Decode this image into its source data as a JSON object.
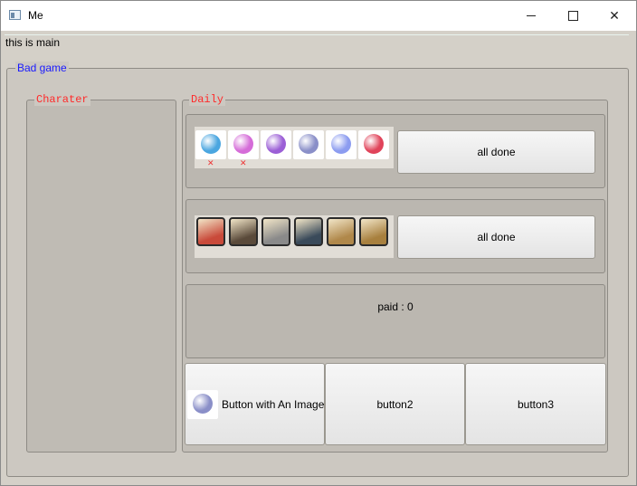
{
  "window": {
    "title": "Me",
    "controls": [
      "minimize",
      "maximize",
      "close"
    ]
  },
  "menubar": {
    "text": "this is main"
  },
  "main_group": {
    "title": "Bad game"
  },
  "character_group": {
    "title": "Charater"
  },
  "daily_group": {
    "title": "Daily",
    "row1": {
      "items": [
        {
          "icon": "blue-orb-icon",
          "color": "#4aa6e0",
          "status": "x"
        },
        {
          "icon": "pink-orb-icon",
          "color": "#d56cd8",
          "status": "x"
        },
        {
          "icon": "purple-orb-icon",
          "color": "#9b5fd6",
          "status": ""
        },
        {
          "icon": "mech-orb-icon",
          "color": "#8a8fc8",
          "status": ""
        },
        {
          "icon": "white-orb-icon",
          "color": "#8c9cf0",
          "status": ""
        },
        {
          "icon": "red-crystal-icon",
          "color": "#e0435a",
          "status": ""
        }
      ],
      "status_mark": "✕",
      "done_label": "all done"
    },
    "row2": {
      "items": [
        {
          "icon": "red-hair-face-icon",
          "color": "#c94a3a"
        },
        {
          "icon": "dragon-face-icon",
          "color": "#5a4a3a"
        },
        {
          "icon": "robot-face-icon",
          "color": "#8a8a8a"
        },
        {
          "icon": "dark-hero-face-icon",
          "color": "#3a4a5a"
        },
        {
          "icon": "golden-guard-icon",
          "color": "#b0884a"
        },
        {
          "icon": "golden-knight-icon",
          "color": "#a8803e"
        }
      ],
      "done_label": "all done"
    },
    "paid": {
      "label": "paid : 0"
    },
    "buttons": {
      "image_button": {
        "label": "Button with An Image",
        "icon": "mech-orb-icon",
        "color": "#8a8fc8"
      },
      "button2": {
        "label": "button2"
      },
      "button3": {
        "label": "button3"
      }
    }
  }
}
